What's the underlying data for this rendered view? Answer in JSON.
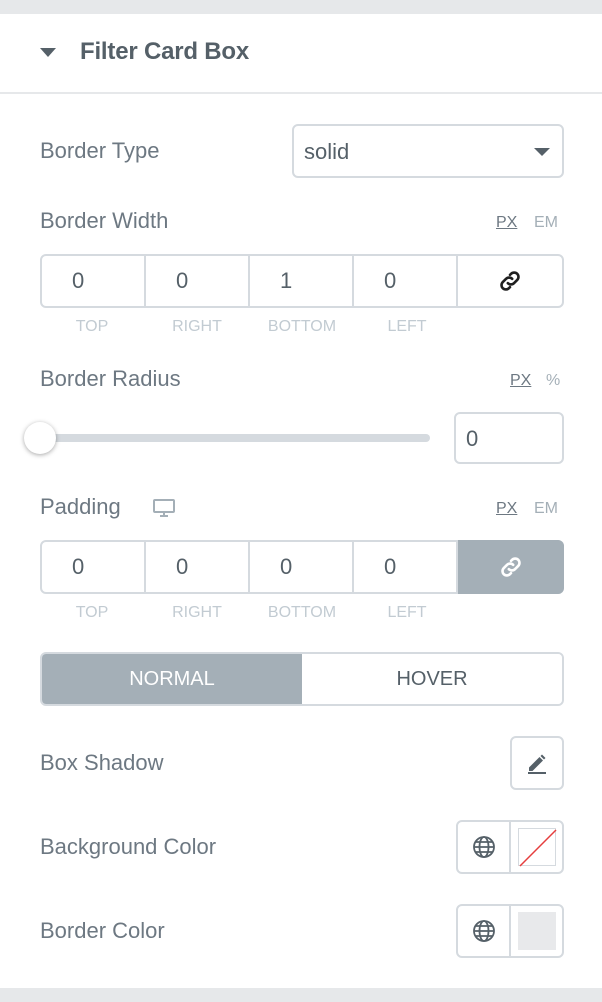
{
  "section": {
    "title": "Filter Card Box"
  },
  "border_type": {
    "label": "Border Type",
    "value": "solid"
  },
  "border_width": {
    "label": "Border Width",
    "units": [
      "PX",
      "EM"
    ],
    "active_unit": "PX",
    "values": [
      "0",
      "0",
      "1",
      "0"
    ],
    "sides": [
      "TOP",
      "RIGHT",
      "BOTTOM",
      "LEFT"
    ]
  },
  "border_radius": {
    "label": "Border Radius",
    "units": [
      "PX",
      "%"
    ],
    "active_unit": "PX",
    "value": "0"
  },
  "padding": {
    "label": "Padding",
    "units": [
      "PX",
      "EM"
    ],
    "active_unit": "PX",
    "values": [
      "0",
      "0",
      "0",
      "0"
    ],
    "sides": [
      "TOP",
      "RIGHT",
      "BOTTOM",
      "LEFT"
    ]
  },
  "tabs": {
    "normal": "NORMAL",
    "hover": "HOVER",
    "active": "NORMAL"
  },
  "box_shadow": {
    "label": "Box Shadow"
  },
  "background_color": {
    "label": "Background Color"
  },
  "border_color": {
    "label": "Border Color",
    "swatch": "#e8e9eb"
  },
  "colors": {
    "accent": "#a4afb7",
    "text": "#6d7882",
    "border": "#d5dadf"
  }
}
